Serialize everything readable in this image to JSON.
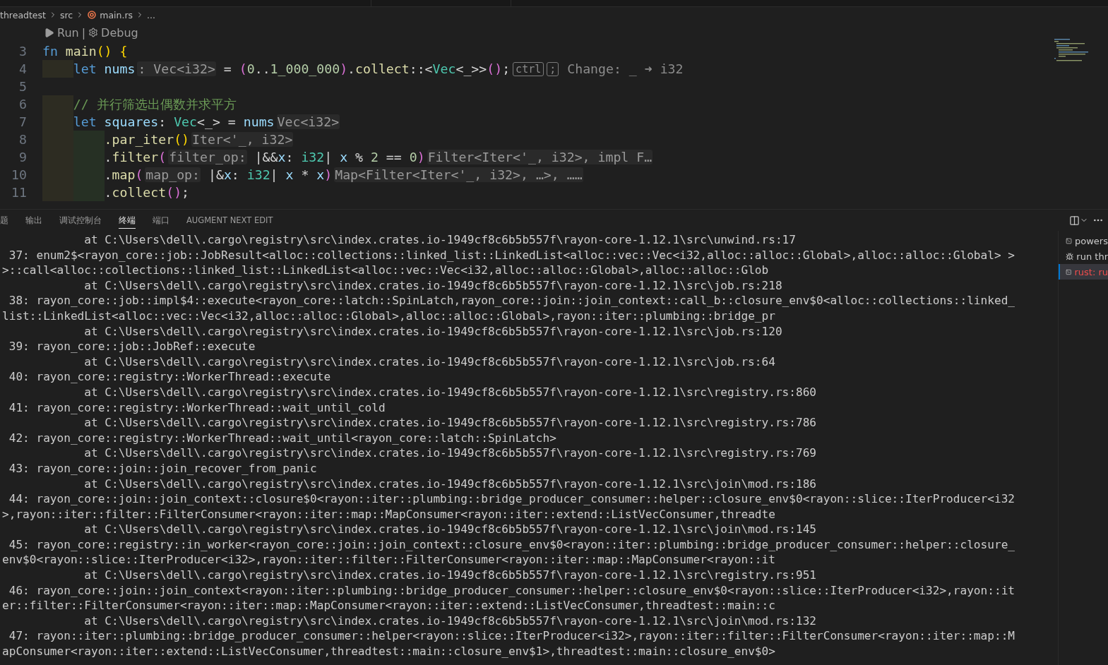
{
  "breadcrumb": [
    {
      "kind": "folder",
      "label": "threadtest"
    },
    {
      "kind": "folder",
      "label": "src"
    },
    {
      "kind": "rust",
      "label": "main.rs"
    },
    {
      "kind": "more",
      "label": "..."
    }
  ],
  "codelens": {
    "items": [
      {
        "kind": "run",
        "label": "Run"
      },
      {
        "kind": "debug",
        "label": "Debug"
      }
    ],
    "separator": "|"
  },
  "code_lines": [
    {
      "number": "3",
      "tokens": [
        {
          "kind": "keyword",
          "text": "fn "
        },
        {
          "kind": "func",
          "text": "main"
        },
        {
          "kind": "bracket1",
          "text": "()"
        },
        {
          "kind": "bracket1",
          "text": " {"
        }
      ]
    },
    {
      "number": "4",
      "tokens": [
        {
          "kind": "indent"
        },
        {
          "kind": "keyword",
          "text": "let "
        },
        {
          "kind": "var",
          "text": "nums"
        },
        {
          "kind": "hint",
          "text": ": Vec<i32>"
        },
        {
          "kind": "plain",
          "text": " = "
        },
        {
          "kind": "bracket2",
          "text": "("
        },
        {
          "kind": "num",
          "text": "0"
        },
        {
          "kind": "plain",
          "text": ".."
        },
        {
          "kind": "num",
          "text": "1_000_000"
        },
        {
          "kind": "bracket2",
          "text": ")"
        },
        {
          "kind": "plain",
          "text": "."
        },
        {
          "kind": "func",
          "text": "collect"
        },
        {
          "kind": "plain",
          "text": "::<"
        },
        {
          "kind": "type",
          "text": "Vec"
        },
        {
          "kind": "plain",
          "text": "<_>>"
        },
        {
          "kind": "bracket2",
          "text": "()"
        },
        {
          "kind": "plain",
          "text": ";"
        },
        {
          "kind": "key",
          "text": "ctrl"
        },
        {
          "kind": "key",
          "text": ";"
        },
        {
          "kind": "ghost",
          "text": "Change: _ ➜ i32"
        }
      ]
    },
    {
      "number": "5"
    },
    {
      "number": "6",
      "tokens": [
        {
          "kind": "indent"
        },
        {
          "kind": "comment",
          "text": "// 并行筛选出偶数并求平方"
        }
      ]
    },
    {
      "number": "7",
      "tokens": [
        {
          "kind": "indent"
        },
        {
          "kind": "keyword",
          "text": "let "
        },
        {
          "kind": "var",
          "text": "squares"
        },
        {
          "kind": "plain",
          "text": ": "
        },
        {
          "kind": "type",
          "text": "Vec"
        },
        {
          "kind": "plain",
          "text": "<_> = "
        },
        {
          "kind": "var",
          "text": "nums"
        },
        {
          "kind": "hint",
          "text": "Vec<i32>"
        }
      ]
    },
    {
      "number": "8",
      "tokens": [
        {
          "kind": "indent"
        },
        {
          "kind": "indent"
        },
        {
          "kind": "func",
          "text": ".par_iter"
        },
        {
          "kind": "bracket1",
          "text": "()"
        },
        {
          "kind": "hint",
          "text": "Iter<'_, i32>"
        }
      ]
    },
    {
      "number": "9",
      "tokens": [
        {
          "kind": "indent"
        },
        {
          "kind": "indent"
        },
        {
          "kind": "plain",
          "text": "."
        },
        {
          "kind": "func",
          "text": "filter"
        },
        {
          "kind": "bracket2",
          "text": "("
        },
        {
          "kind": "hint",
          "text": "filter_op:"
        },
        {
          "kind": "plain",
          "text": " |&&"
        },
        {
          "kind": "var",
          "text": "x"
        },
        {
          "kind": "plain",
          "text": ": "
        },
        {
          "kind": "type",
          "text": "i32"
        },
        {
          "kind": "plain",
          "text": "| "
        },
        {
          "kind": "var",
          "text": "x"
        },
        {
          "kind": "plain",
          "text": " % "
        },
        {
          "kind": "num",
          "text": "2"
        },
        {
          "kind": "plain",
          "text": " == "
        },
        {
          "kind": "num",
          "text": "0"
        },
        {
          "kind": "bracket2",
          "text": ")"
        },
        {
          "kind": "hint",
          "text": "Filter<Iter<'_, i32>, impl F…"
        }
      ]
    },
    {
      "number": "10",
      "tokens": [
        {
          "kind": "indent"
        },
        {
          "kind": "indent"
        },
        {
          "kind": "plain",
          "text": "."
        },
        {
          "kind": "func",
          "text": "map"
        },
        {
          "kind": "bracket2",
          "text": "("
        },
        {
          "kind": "hint",
          "text": "map_op:"
        },
        {
          "kind": "plain",
          "text": " |&"
        },
        {
          "kind": "var",
          "text": "x"
        },
        {
          "kind": "plain",
          "text": ": "
        },
        {
          "kind": "type",
          "text": "i32"
        },
        {
          "kind": "plain",
          "text": "| "
        },
        {
          "kind": "var",
          "text": "x"
        },
        {
          "kind": "plain",
          "text": " * "
        },
        {
          "kind": "var",
          "text": "x"
        },
        {
          "kind": "bracket2",
          "text": ")"
        },
        {
          "kind": "hint",
          "text": "Map<Filter<Iter<'_, i32>, …>, ……"
        }
      ]
    },
    {
      "number": "11",
      "tokens": [
        {
          "kind": "indent"
        },
        {
          "kind": "indent"
        },
        {
          "kind": "plain",
          "text": "."
        },
        {
          "kind": "func",
          "text": "collect"
        },
        {
          "kind": "bracket2",
          "text": "()"
        },
        {
          "kind": "plain",
          "text": ";"
        }
      ]
    }
  ],
  "panel_tabs": [
    {
      "label": "题",
      "selected": false
    },
    {
      "label": "输出",
      "selected": false
    },
    {
      "label": "调试控制台",
      "selected": false
    },
    {
      "label": "终端",
      "selected": true
    },
    {
      "label": "端口",
      "selected": false
    },
    {
      "label": "AUGMENT NEXT EDIT",
      "selected": false
    }
  ],
  "terminal_lines": [
    {
      "kind": "location",
      "text": "at C:\\Users\\dell\\.cargo\\registry\\src\\index.crates.io-1949cf8c6b5b557f\\rayon-core-1.12.1\\src\\unwind.rs:17"
    },
    {
      "kind": "frame",
      "text": "37: enum2$<rayon_core::job::JobResult<alloc::collections::linked_list::LinkedList<alloc::vec::Vec<i32,alloc::alloc::Global>,alloc::alloc::Global> >"
    },
    {
      "kind": "wrap",
      "text": ">::call<alloc::collections::linked_list::LinkedList<alloc::vec::Vec<i32,alloc::alloc::Global>,alloc::alloc::Glob"
    },
    {
      "kind": "location",
      "text": "at C:\\Users\\dell\\.cargo\\registry\\src\\index.crates.io-1949cf8c6b5b557f\\rayon-core-1.12.1\\src\\job.rs:218"
    },
    {
      "kind": "frame",
      "text": "38: rayon_core::job::impl$4::execute<rayon_core::latch::SpinLatch,rayon_core::join::join_context::call_b::closure_env$0<alloc::collections::linked_"
    },
    {
      "kind": "wrap",
      "text": "list::LinkedList<alloc::vec::Vec<i32,alloc::alloc::Global>,alloc::alloc::Global>,rayon::iter::plumbing::bridge_pr"
    },
    {
      "kind": "location",
      "text": "at C:\\Users\\dell\\.cargo\\registry\\src\\index.crates.io-1949cf8c6b5b557f\\rayon-core-1.12.1\\src\\job.rs:120"
    },
    {
      "kind": "frame",
      "text": "39: rayon_core::job::JobRef::execute"
    },
    {
      "kind": "location",
      "text": "at C:\\Users\\dell\\.cargo\\registry\\src\\index.crates.io-1949cf8c6b5b557f\\rayon-core-1.12.1\\src\\job.rs:64"
    },
    {
      "kind": "frame",
      "text": "40: rayon_core::registry::WorkerThread::execute"
    },
    {
      "kind": "location",
      "text": "at C:\\Users\\dell\\.cargo\\registry\\src\\index.crates.io-1949cf8c6b5b557f\\rayon-core-1.12.1\\src\\registry.rs:860"
    },
    {
      "kind": "frame",
      "text": "41: rayon_core::registry::WorkerThread::wait_until_cold"
    },
    {
      "kind": "location",
      "text": "at C:\\Users\\dell\\.cargo\\registry\\src\\index.crates.io-1949cf8c6b5b557f\\rayon-core-1.12.1\\src\\registry.rs:786"
    },
    {
      "kind": "frame",
      "text": "42: rayon_core::registry::WorkerThread::wait_until<rayon_core::latch::SpinLatch>"
    },
    {
      "kind": "location",
      "text": "at C:\\Users\\dell\\.cargo\\registry\\src\\index.crates.io-1949cf8c6b5b557f\\rayon-core-1.12.1\\src\\registry.rs:769"
    },
    {
      "kind": "frame",
      "text": "43: rayon_core::join::join_recover_from_panic"
    },
    {
      "kind": "location",
      "text": "at C:\\Users\\dell\\.cargo\\registry\\src\\index.crates.io-1949cf8c6b5b557f\\rayon-core-1.12.1\\src\\join\\mod.rs:186"
    },
    {
      "kind": "frame",
      "text": "44: rayon_core::join::join_context::closure$0<rayon::iter::plumbing::bridge_producer_consumer::helper::closure_env$0<rayon::slice::IterProducer<i32"
    },
    {
      "kind": "wrap",
      "text": ">,rayon::iter::filter::FilterConsumer<rayon::iter::map::MapConsumer<rayon::iter::extend::ListVecConsumer,threadte"
    },
    {
      "kind": "location",
      "text": "at C:\\Users\\dell\\.cargo\\registry\\src\\index.crates.io-1949cf8c6b5b557f\\rayon-core-1.12.1\\src\\join\\mod.rs:145"
    },
    {
      "kind": "frame",
      "text": "45: rayon_core::registry::in_worker<rayon_core::join::join_context::closure_env$0<rayon::iter::plumbing::bridge_producer_consumer::helper::closure_"
    },
    {
      "kind": "wrap",
      "text": "env$0<rayon::slice::IterProducer<i32>,rayon::iter::filter::FilterConsumer<rayon::iter::map::MapConsumer<rayon::it"
    },
    {
      "kind": "location",
      "text": "at C:\\Users\\dell\\.cargo\\registry\\src\\index.crates.io-1949cf8c6b5b557f\\rayon-core-1.12.1\\src\\registry.rs:951"
    },
    {
      "kind": "frame",
      "text": "46: rayon_core::join::join_context<rayon::iter::plumbing::bridge_producer_consumer::helper::closure_env$0<rayon::slice::IterProducer<i32>,rayon::it"
    },
    {
      "kind": "wrap",
      "text": "er::filter::FilterConsumer<rayon::iter::map::MapConsumer<rayon::iter::extend::ListVecConsumer,threadtest::main::c"
    },
    {
      "kind": "location",
      "text": "at C:\\Users\\dell\\.cargo\\registry\\src\\index.crates.io-1949cf8c6b5b557f\\rayon-core-1.12.1\\src\\join\\mod.rs:132"
    },
    {
      "kind": "frame",
      "text": "47: rayon::iter::plumbing::bridge_producer_consumer::helper<rayon::slice::IterProducer<i32>,rayon::iter::filter::FilterConsumer<rayon::iter::map::M"
    },
    {
      "kind": "wrap",
      "text": "apConsumer<rayon::iter::extend::ListVecConsumer,threadtest::main::closure_env$1>,threadtest::main::closure_env$0>"
    }
  ],
  "terminal_list": [
    {
      "kind": "shell",
      "label": "powers",
      "selected": false
    },
    {
      "kind": "debug",
      "label": "run thr",
      "selected": false
    },
    {
      "kind": "shell",
      "label": "rust: ru",
      "selected": true
    }
  ]
}
